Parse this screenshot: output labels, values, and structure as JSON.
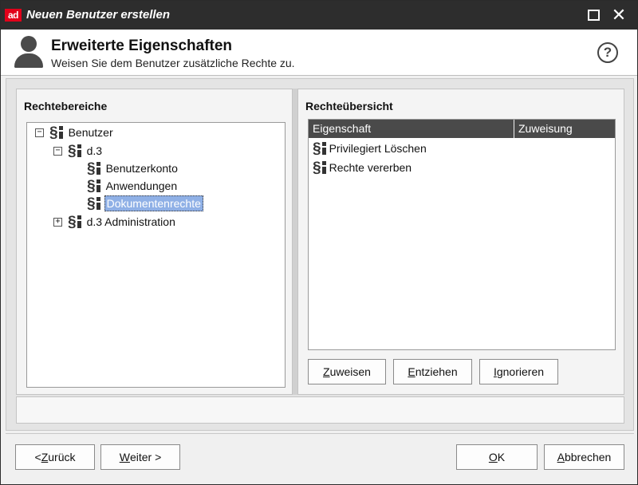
{
  "window": {
    "logo_text": "ad",
    "title": "Neuen Benutzer erstellen",
    "maximize_icon": "maximize-icon",
    "close_symbol": "✕"
  },
  "header": {
    "title": "Erweiterte Eigenschaften",
    "subtitle": "Weisen Sie dem Benutzer zusätzliche Rechte zu.",
    "help_symbol": "?"
  },
  "left_panel": {
    "heading": "Rechtebereiche",
    "tree": [
      {
        "label": "Benutzer",
        "toggle": "−",
        "level": 0,
        "selected": false
      },
      {
        "label": "d.3",
        "toggle": "−",
        "level": 1,
        "selected": false
      },
      {
        "label": "Benutzerkonto",
        "toggle": "",
        "level": 2,
        "selected": false
      },
      {
        "label": "Anwendungen",
        "toggle": "",
        "level": 2,
        "selected": false
      },
      {
        "label": "Dokumentenrechte",
        "toggle": "",
        "level": 2,
        "selected": true
      },
      {
        "label": "d.3 Administration",
        "toggle": "+",
        "level": 1,
        "selected": false
      }
    ]
  },
  "right_panel": {
    "heading": "Rechteübersicht",
    "columns": [
      "Eigenschaft",
      "Zuweisung"
    ],
    "rows": [
      {
        "property": "Privilegiert Löschen",
        "assignment": ""
      },
      {
        "property": "Rechte vererben",
        "assignment": ""
      }
    ],
    "buttons": {
      "assign": {
        "pre": "",
        "mnemonic": "Z",
        "post": "uweisen"
      },
      "revoke": {
        "pre": "",
        "mnemonic": "E",
        "post": "ntziehen"
      },
      "ignore": {
        "pre": "",
        "mnemonic": "I",
        "post": "gnorieren"
      }
    }
  },
  "footer": {
    "back": {
      "pre": "< ",
      "mnemonic": "Z",
      "post": "urück"
    },
    "next": {
      "pre": "",
      "mnemonic": "W",
      "post": "eiter >"
    },
    "ok": {
      "pre": "",
      "mnemonic": "O",
      "post": "K"
    },
    "cancel": {
      "pre": "",
      "mnemonic": "A",
      "post": "bbrechen"
    }
  },
  "colors": {
    "titlebar": "#2d2d2d",
    "logo": "#e2001a",
    "table_header": "#4a4a4a",
    "selection": "#8fb0e6"
  },
  "icons": {
    "user": "user-avatar-icon",
    "right": "paragraph-rights-icon",
    "help": "help-circle-icon"
  }
}
